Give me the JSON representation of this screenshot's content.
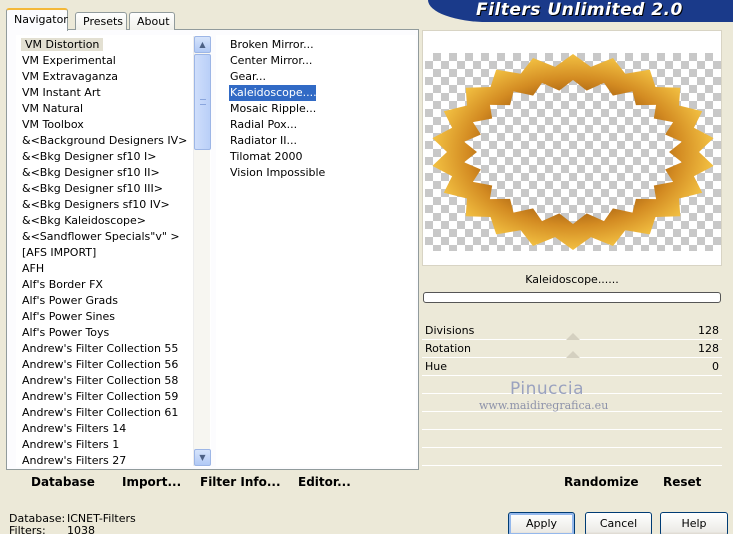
{
  "tabs": [
    "Navigator",
    "Presets",
    "About"
  ],
  "banner_title": "Filters Unlimited 2.0",
  "categories": [
    "VM Distortion",
    "VM Experimental",
    "VM Extravaganza",
    "VM Instant Art",
    "VM Natural",
    "VM Toolbox",
    "&<Background Designers IV>",
    "&<Bkg Designer sf10 I>",
    "&<Bkg Designer sf10 II>",
    "&<Bkg Designer sf10 III>",
    "&<Bkg Designers sf10 IV>",
    "&<Bkg Kaleidoscope>",
    "&<Sandflower Specials\"v\" >",
    "[AFS IMPORT]",
    "AFH",
    "Alf's Border FX",
    "Alf's Power Grads",
    "Alf's Power Sines",
    "Alf's Power Toys",
    "Andrew's Filter Collection 55",
    "Andrew's Filter Collection 56",
    "Andrew's Filter Collection 58",
    "Andrew's Filter Collection 59",
    "Andrew's Filter Collection 61",
    "Andrew's Filters 14",
    "Andrew's Filters 1",
    "Andrew's Filters 27"
  ],
  "selected_category": "VM Distortion",
  "filters": [
    "Broken Mirror...",
    "Center Mirror...",
    "Gear...",
    "Kaleidoscope......",
    "Mosaic Ripple...",
    "Radial Pox...",
    "Radiator II...",
    "Tilomat 2000",
    "Vision Impossible"
  ],
  "selected_filter": "Kaleidoscope......",
  "bottom_buttons": {
    "database": "Database",
    "import": "Import...",
    "filter_info": "Filter Info...",
    "editor": "Editor..."
  },
  "filter_label": "Kaleidoscope......",
  "params": [
    {
      "name": "Divisions",
      "value": "128"
    },
    {
      "name": "Rotation",
      "value": "128"
    },
    {
      "name": "Hue",
      "value": "0"
    }
  ],
  "watermark": {
    "name": "Pinuccia",
    "site": "www.maidiregrafica.eu"
  },
  "randomize_label": "Randomize",
  "reset_label": "Reset",
  "status": {
    "database_label": "Database:",
    "database_value": "ICNET-Filters",
    "filters_label": "Filters:",
    "filters_value": "1038"
  },
  "dialog": {
    "apply": "Apply",
    "cancel": "Cancel",
    "help": "Help"
  },
  "colors": {
    "banner": "#1a3a8a",
    "selection": "#316ac5",
    "ring_outer": "#e9a92a",
    "ring_inner": "#b86a12"
  }
}
